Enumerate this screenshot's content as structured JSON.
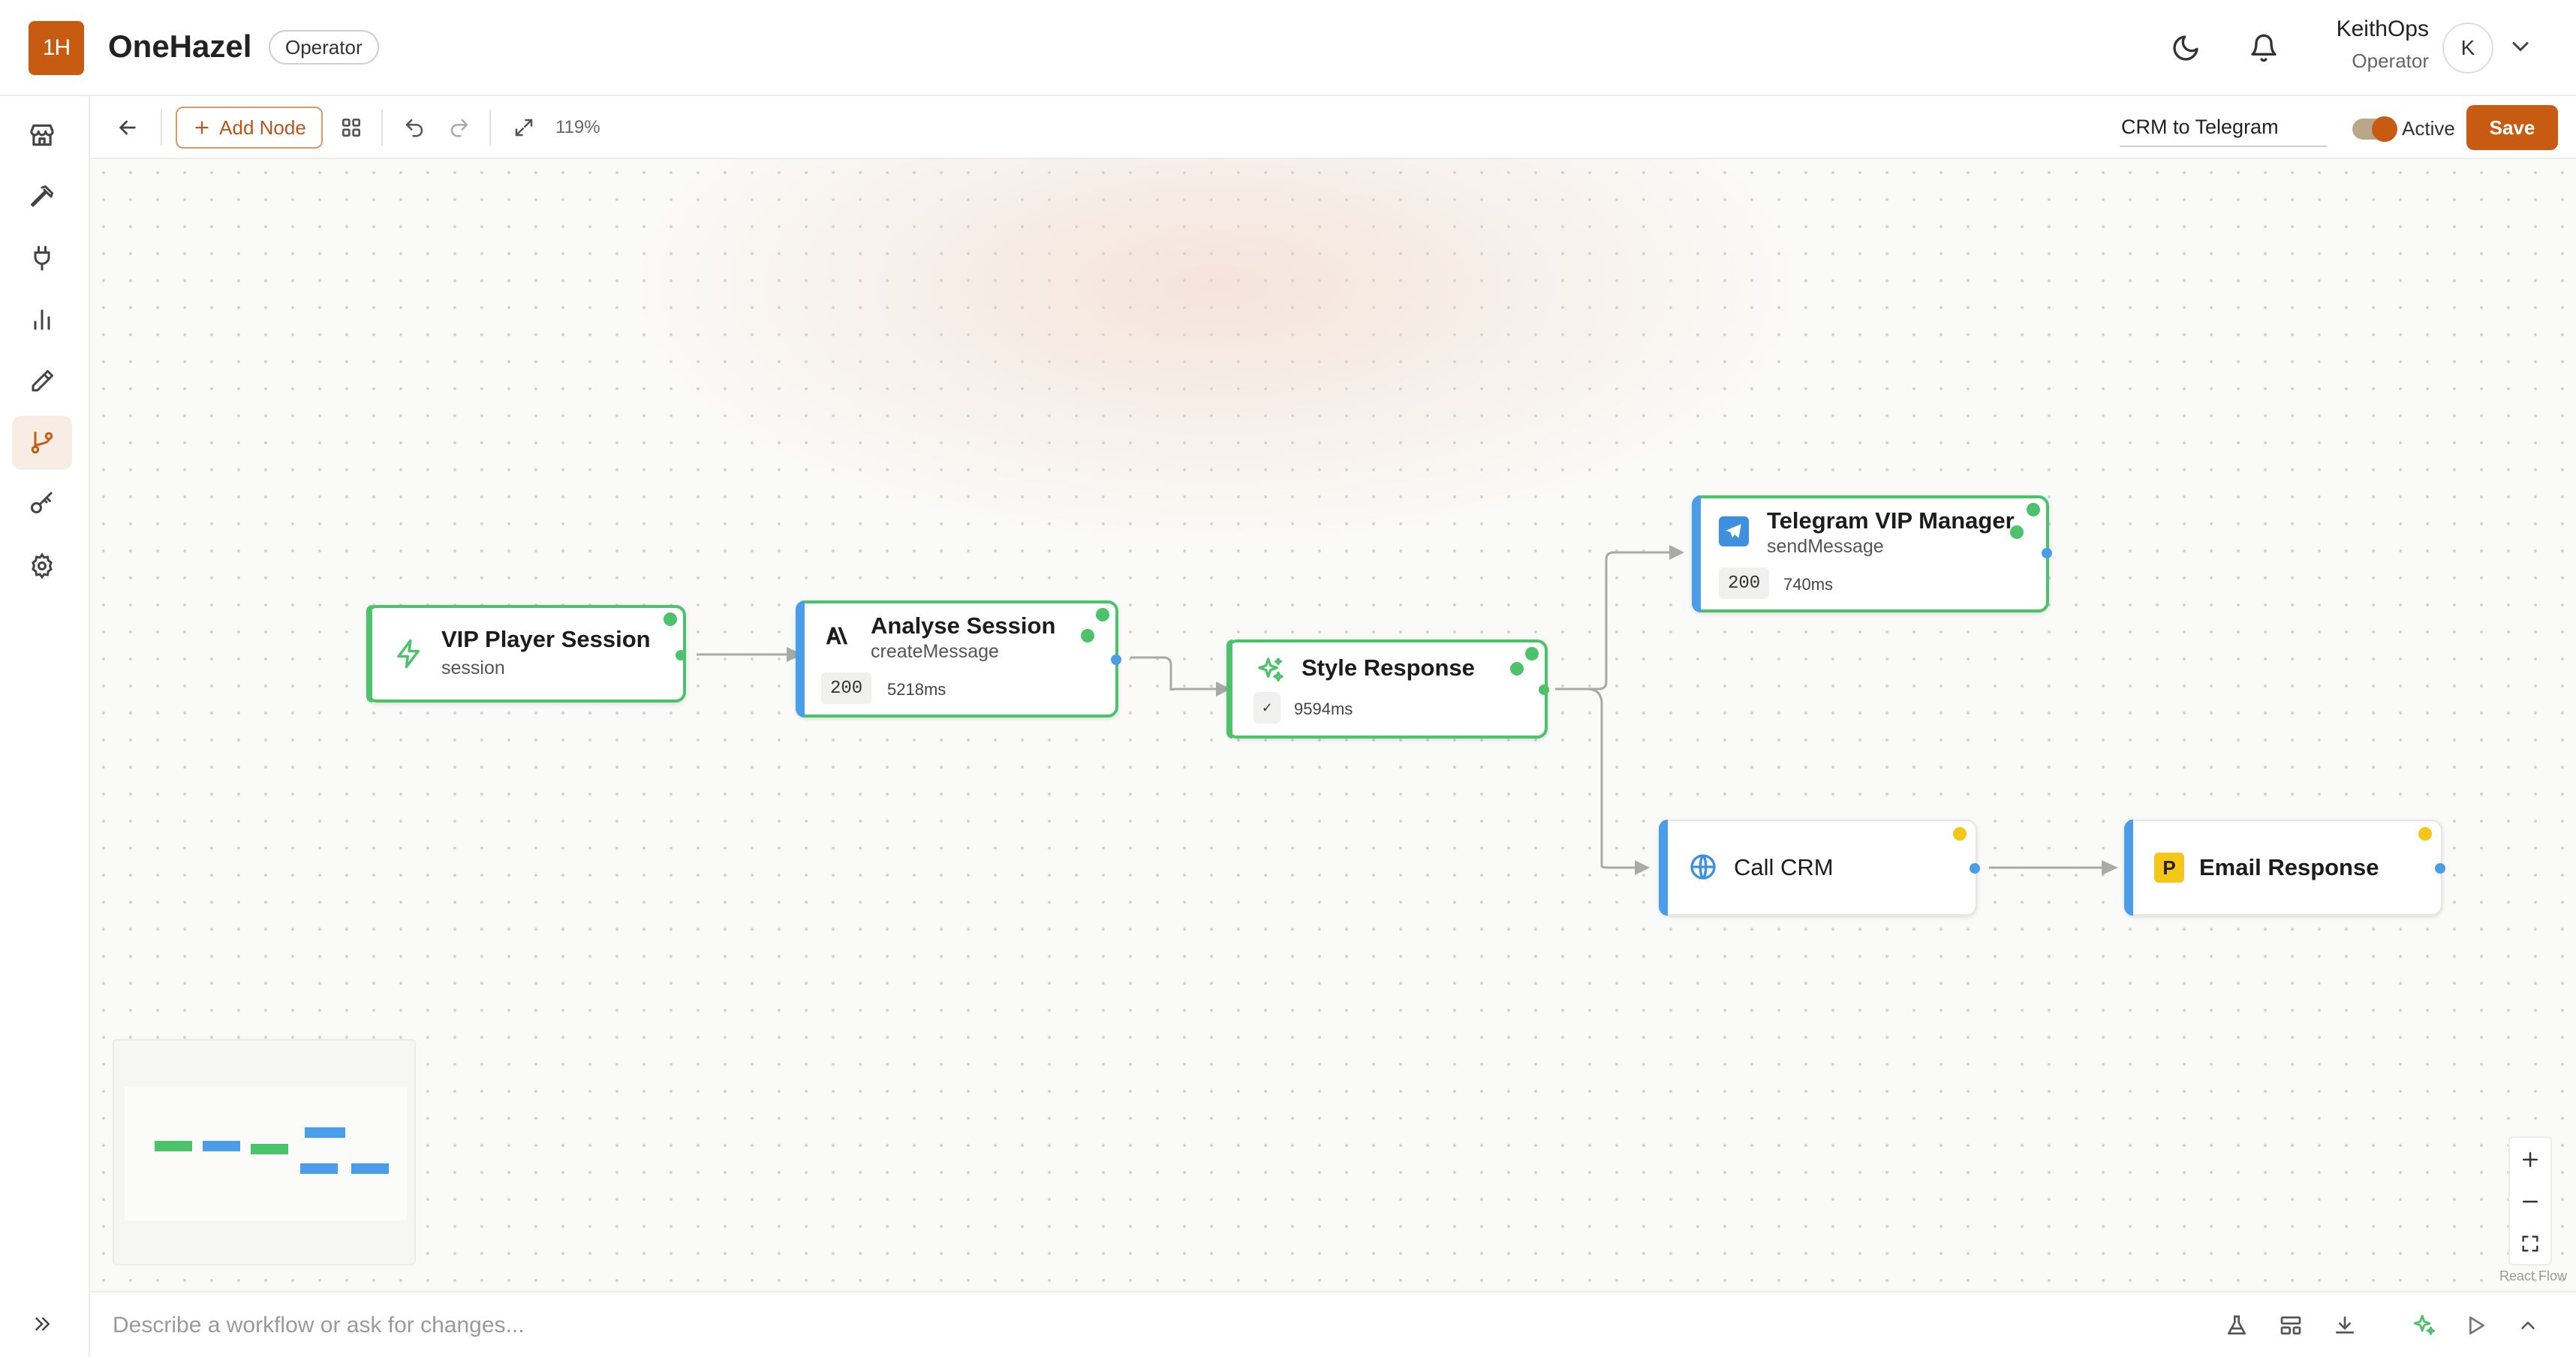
{
  "brand": {
    "logo_text": "1H",
    "app_name": "OneHazel",
    "role_badge": "Operator"
  },
  "user": {
    "name": "KeithOps",
    "role": "Operator",
    "avatar_initial": "K"
  },
  "sidebar": {
    "items": [
      {
        "name": "store",
        "icon": "store-icon"
      },
      {
        "name": "tools",
        "icon": "hammer-icon"
      },
      {
        "name": "integrations",
        "icon": "plug-icon"
      },
      {
        "name": "analytics",
        "icon": "bar-chart-icon"
      },
      {
        "name": "design",
        "icon": "pen-icon"
      },
      {
        "name": "workflows",
        "icon": "git-branch-icon",
        "active": true
      },
      {
        "name": "keys",
        "icon": "key-icon"
      },
      {
        "name": "settings",
        "icon": "gear-icon"
      }
    ]
  },
  "toolbar": {
    "add_node_label": "Add Node",
    "zoom": "119%",
    "workflow_name": "CRM to Telegram",
    "active_label": "Active",
    "active": true,
    "save_label": "Save"
  },
  "nodes": [
    {
      "id": "vip",
      "title": "VIP Player Session",
      "subtitle": "session",
      "icon": "bolt-icon",
      "state": "ok"
    },
    {
      "id": "analyse",
      "title": "Analyse Session",
      "subtitle": "createMessage",
      "icon": "anthropic-icon",
      "status": "200",
      "duration": "5218ms",
      "state": "ok"
    },
    {
      "id": "style",
      "title": "Style Response",
      "icon": "sparkles-icon",
      "status": "✓",
      "duration": "9594ms",
      "state": "ok"
    },
    {
      "id": "telegram",
      "title": "Telegram VIP Manager",
      "subtitle": "sendMessage",
      "icon": "telegram-icon",
      "status": "200",
      "duration": "740ms",
      "state": "ok"
    },
    {
      "id": "crm",
      "title": "Call CRM",
      "icon": "globe-icon",
      "state": "pending"
    },
    {
      "id": "email",
      "title": "Email Response",
      "icon": "postmark-icon",
      "icon_letter": "P",
      "state": "pending"
    }
  ],
  "colors": {
    "accent": "#c75b12",
    "success": "#4cc26a",
    "info": "#4a9de8",
    "pending": "#f5c518"
  },
  "canvas": {
    "attribution": "React Flow"
  },
  "prompt": {
    "placeholder": "Describe a workflow or ask for changes..."
  }
}
